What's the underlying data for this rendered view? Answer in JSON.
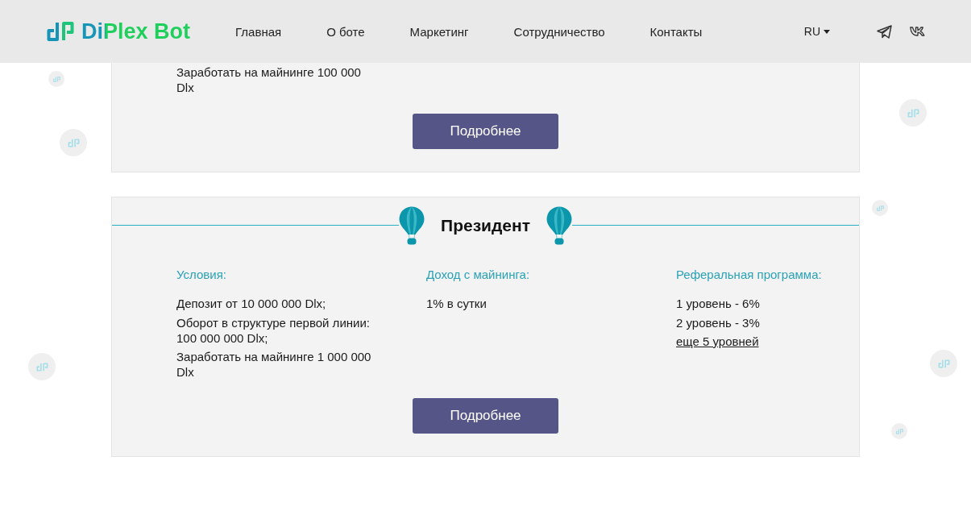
{
  "header": {
    "logo": "DiPlex Bot",
    "nav": [
      "Главная",
      "О боте",
      "Маркетинг",
      "Сотрудничество",
      "Контакты"
    ],
    "language": "RU"
  },
  "plans": [
    {
      "columns": [
        {
          "items": [
            "Заработать на майнинге 100 000 Dlx"
          ]
        }
      ],
      "button": "Подробнее"
    },
    {
      "title": "Президент",
      "columns": [
        {
          "heading": "Условия:",
          "items": [
            "Депозит от 10 000 000 Dlx;",
            "Оборот в структуре первой линии: 100 000 000 Dlx;",
            "Заработать на майнинге 1 000 000 Dlx"
          ]
        },
        {
          "heading": "Доход с майнинга:",
          "items": [
            "1% в сутки"
          ]
        },
        {
          "heading": "Реферальная программа:",
          "items": [
            "1 уровень - 6%",
            "2 уровень - 3%"
          ],
          "link": "еще 5 уровней"
        }
      ],
      "button": "Подробнее"
    }
  ]
}
